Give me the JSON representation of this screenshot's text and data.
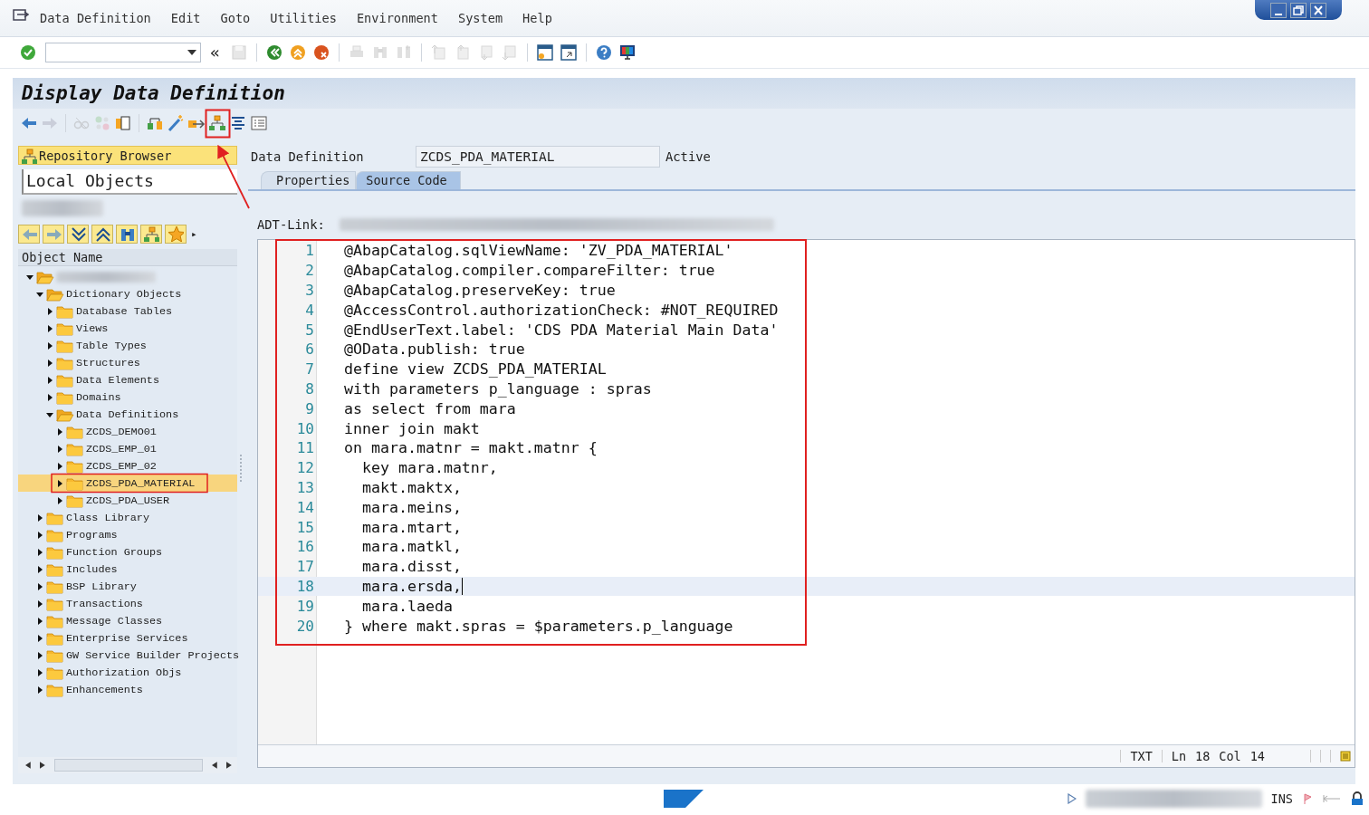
{
  "menu": [
    {
      "label": "Data Definition"
    },
    {
      "label": "Edit"
    },
    {
      "label": "Goto"
    },
    {
      "label": "Utilities"
    },
    {
      "label": "Environment"
    },
    {
      "label": "System"
    },
    {
      "label": "Help"
    }
  ],
  "toolbar": {
    "collapse": "«",
    "buttons": [
      {
        "disabled": false
      },
      {
        "disabled": true
      },
      {
        "disabled": false
      },
      {
        "disabled": false
      },
      {
        "disabled": false
      },
      {
        "disabled": true
      },
      {
        "disabled": true
      },
      {
        "disabled": true
      },
      {
        "disabled": true
      },
      {
        "disabled": true
      },
      {
        "disabled": true
      },
      {
        "disabled": true
      },
      {
        "disabled": false
      },
      {
        "disabled": false
      },
      {
        "disabled": false
      },
      {
        "disabled": false
      }
    ]
  },
  "title": "Display Data Definition",
  "app_toolbar": [
    {
      "disabled": false
    },
    {
      "disabled": true
    },
    {
      "disabled": true
    },
    {
      "disabled": true
    },
    {
      "disabled": false
    },
    {
      "disabled": false
    },
    {
      "disabled": false
    },
    {
      "disabled": false
    },
    {
      "disabled": false
    },
    {
      "disabled": false
    },
    {
      "disabled": false
    }
  ],
  "sidebar": {
    "header": "Repository Browser",
    "object_list": "Local Objects",
    "tree_more": "▸",
    "column": "Object Name",
    "tree": [
      {
        "expanded": true,
        "selected": false,
        "children": [
          {
            "label": "Dictionary Objects",
            "expanded": true,
            "selected": false,
            "children": [
              {
                "label": "Database Tables",
                "expanded": false,
                "selected": false
              },
              {
                "label": "Views",
                "expanded": false,
                "selected": false
              },
              {
                "label": "Table Types",
                "expanded": false,
                "selected": false
              },
              {
                "label": "Structures",
                "expanded": false,
                "selected": false
              },
              {
                "label": "Data Elements",
                "expanded": false,
                "selected": false
              },
              {
                "label": "Domains",
                "expanded": false,
                "selected": false
              },
              {
                "label": "Data Definitions",
                "expanded": true,
                "selected": false,
                "children": [
                  {
                    "label": "ZCDS_DEMO01",
                    "expanded": false,
                    "selected": false
                  },
                  {
                    "label": "ZCDS_EMP_01",
                    "expanded": false,
                    "selected": false
                  },
                  {
                    "label": "ZCDS_EMP_02",
                    "expanded": false,
                    "selected": false
                  },
                  {
                    "label": "ZCDS_PDA_MATERIAL",
                    "expanded": false,
                    "selected": true
                  },
                  {
                    "label": "ZCDS_PDA_USER",
                    "expanded": false,
                    "selected": false
                  }
                ]
              }
            ]
          },
          {
            "label": "Class Library",
            "expanded": false,
            "selected": false
          },
          {
            "label": "Programs",
            "expanded": false,
            "selected": false
          },
          {
            "label": "Function Groups",
            "expanded": false,
            "selected": false
          },
          {
            "label": "Includes",
            "expanded": false,
            "selected": false
          },
          {
            "label": "BSP Library",
            "expanded": false,
            "selected": false
          },
          {
            "label": "Transactions",
            "expanded": false,
            "selected": false
          },
          {
            "label": "Message Classes",
            "expanded": false,
            "selected": false
          },
          {
            "label": "Enterprise Services",
            "expanded": false,
            "selected": false
          },
          {
            "label": "GW Service Builder Projects",
            "expanded": false,
            "selected": false
          },
          {
            "label": "Authorization Objs",
            "expanded": false,
            "selected": false
          },
          {
            "label": "Enhancements",
            "expanded": false,
            "selected": false
          }
        ]
      }
    ]
  },
  "header_fields": {
    "label": "Data Definition",
    "value": "ZCDS_PDA_MATERIAL",
    "status": "Active"
  },
  "tabs": [
    {
      "label": "Properties",
      "selected": false
    },
    {
      "label": "Source Code",
      "selected": true
    }
  ],
  "adt_link_label": "ADT-Link:",
  "editor": {
    "lines": [
      {
        "number": "1",
        "text": "@AbapCatalog.sqlViewName: 'ZV_PDA_MATERIAL'",
        "current": false
      },
      {
        "number": "2",
        "text": "@AbapCatalog.compiler.compareFilter: true",
        "current": false
      },
      {
        "number": "3",
        "text": "@AbapCatalog.preserveKey: true",
        "current": false
      },
      {
        "number": "4",
        "text": "@AccessControl.authorizationCheck: #NOT_REQUIRED",
        "current": false
      },
      {
        "number": "5",
        "text": "@EndUserText.label: 'CDS PDA Material Main Data'",
        "current": false
      },
      {
        "number": "6",
        "text": "@OData.publish: true",
        "current": false
      },
      {
        "number": "7",
        "text": "define view ZCDS_PDA_MATERIAL",
        "current": false
      },
      {
        "number": "8",
        "text": "with parameters p_language : spras",
        "current": false
      },
      {
        "number": "9",
        "text": "as select from mara",
        "current": false
      },
      {
        "number": "10",
        "text": "inner join makt",
        "current": false
      },
      {
        "number": "11",
        "text": "on mara.matnr = makt.matnr {",
        "current": false
      },
      {
        "number": "12",
        "text": "  key mara.matnr,",
        "current": false
      },
      {
        "number": "13",
        "text": "  makt.maktx,",
        "current": false
      },
      {
        "number": "14",
        "text": "  mara.meins,",
        "current": false
      },
      {
        "number": "15",
        "text": "  mara.mtart,",
        "current": false
      },
      {
        "number": "16",
        "text": "  mara.matkl,",
        "current": false
      },
      {
        "number": "17",
        "text": "  mara.disst,",
        "current": false
      },
      {
        "number": "18",
        "text": "  mara.ersda,",
        "current": true
      },
      {
        "number": "19",
        "text": "  mara.laeda",
        "current": false
      },
      {
        "number": "20",
        "text": "} where makt.spras = $parameters.p_language",
        "current": false
      }
    ],
    "status": [
      "TXT",
      "Ln",
      "18",
      "Col",
      "14"
    ]
  },
  "status_bar": {
    "mode": "INS"
  }
}
